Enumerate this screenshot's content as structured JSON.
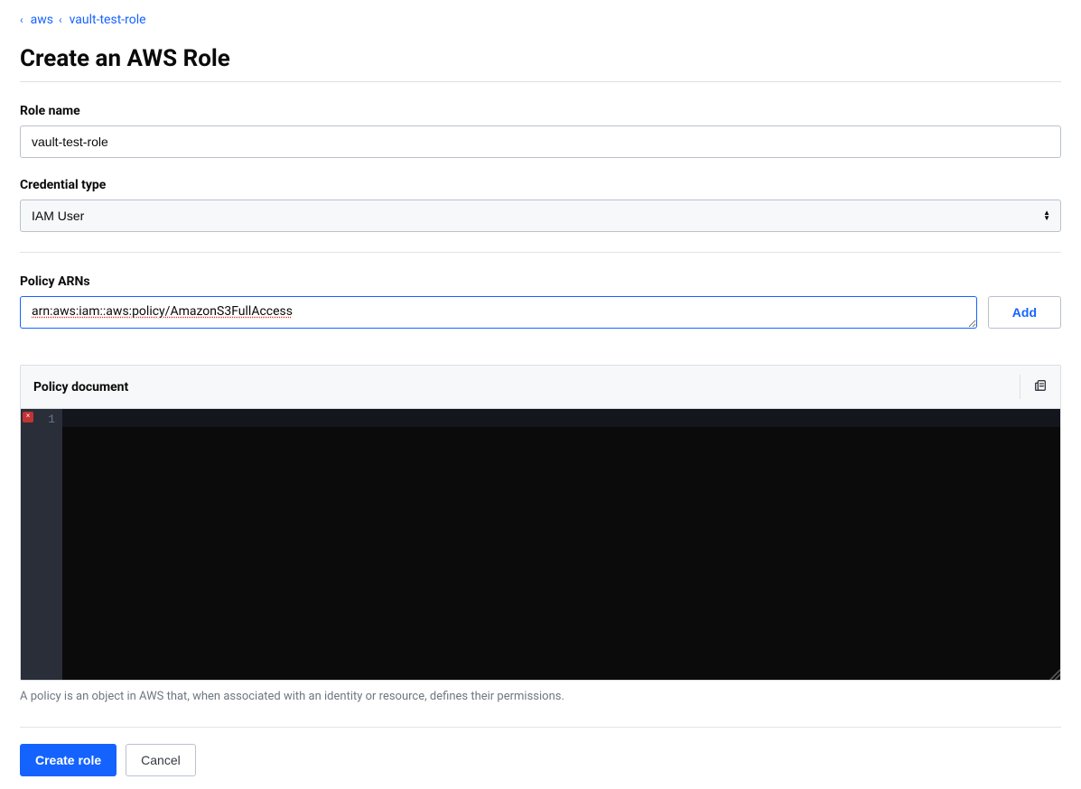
{
  "breadcrumb": {
    "items": [
      {
        "label": "aws"
      },
      {
        "label": "vault-test-role"
      }
    ]
  },
  "page": {
    "title": "Create an AWS Role"
  },
  "form": {
    "role_name": {
      "label": "Role name",
      "value": "vault-test-role"
    },
    "credential_type": {
      "label": "Credential type",
      "value": "IAM User"
    },
    "policy_arns": {
      "label": "Policy ARNs",
      "value": "arn:aws:iam::aws:policy/AmazonS3FullAccess",
      "add_label": "Add"
    },
    "policy_document": {
      "label": "Policy document",
      "line_number": "1",
      "error_glyph": "×",
      "help_text": "A policy is an object in AWS that, when associated with an identity or resource, defines their permissions."
    }
  },
  "footer": {
    "primary_label": "Create role",
    "cancel_label": "Cancel"
  }
}
